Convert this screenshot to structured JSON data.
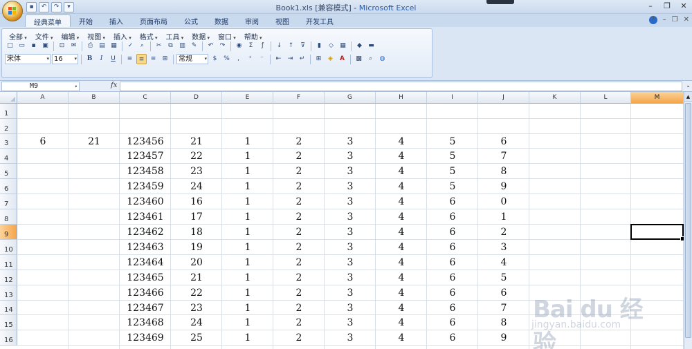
{
  "window": {
    "title_file": "Book1.xls",
    "title_mode": "[兼容模式]",
    "title_app": "Microsoft Excel"
  },
  "ribbon_tabs": [
    "经典菜单",
    "开始",
    "插入",
    "页面布局",
    "公式",
    "数据",
    "审阅",
    "视图",
    "开发工具"
  ],
  "classic_menus": [
    "全部",
    "文件",
    "编辑",
    "视图",
    "插入",
    "格式",
    "工具",
    "数据",
    "窗口",
    "帮助"
  ],
  "toolbar": {
    "font_name": "宋体",
    "font_size": "16",
    "bold": "B",
    "italic": "I",
    "underline": "U",
    "number_format": "常规",
    "percent": "%",
    "comma": ","
  },
  "formula_bar": {
    "name_box": "M9",
    "fx_label": "fx",
    "formula": ""
  },
  "columns": [
    "A",
    "B",
    "C",
    "D",
    "E",
    "F",
    "G",
    "H",
    "I",
    "J",
    "K",
    "L",
    "M"
  ],
  "selected_column": "M",
  "rows": [
    "1",
    "2",
    "3",
    "4",
    "5",
    "6",
    "7",
    "8",
    "9",
    "10",
    "11",
    "12",
    "13",
    "14",
    "15",
    "16"
  ],
  "selected_row": "9",
  "cells": {
    "A3": "6",
    "B3": "21",
    "C": [
      "123456",
      "123457",
      "123458",
      "123459",
      "123460",
      "123461",
      "123462",
      "123463",
      "123464",
      "123465",
      "123466",
      "123467",
      "123468",
      "123469"
    ],
    "D": [
      "21",
      "22",
      "23",
      "24",
      "16",
      "17",
      "18",
      "19",
      "20",
      "21",
      "22",
      "23",
      "24",
      "25"
    ],
    "E": [
      "1",
      "1",
      "1",
      "1",
      "1",
      "1",
      "1",
      "1",
      "1",
      "1",
      "1",
      "1",
      "1",
      "1"
    ],
    "F": [
      "2",
      "2",
      "2",
      "2",
      "2",
      "2",
      "2",
      "2",
      "2",
      "2",
      "2",
      "2",
      "2",
      "2"
    ],
    "G": [
      "3",
      "3",
      "3",
      "3",
      "3",
      "3",
      "3",
      "3",
      "3",
      "3",
      "3",
      "3",
      "3",
      "3"
    ],
    "H": [
      "4",
      "4",
      "4",
      "4",
      "4",
      "4",
      "4",
      "4",
      "4",
      "4",
      "4",
      "4",
      "4",
      "4"
    ],
    "I": [
      "5",
      "5",
      "5",
      "5",
      "6",
      "6",
      "6",
      "6",
      "6",
      "6",
      "6",
      "6",
      "6",
      "6"
    ],
    "J": [
      "6",
      "7",
      "8",
      "9",
      "0",
      "1",
      "2",
      "3",
      "4",
      "5",
      "6",
      "7",
      "8",
      "9"
    ]
  },
  "watermark": {
    "brand": "Bai du 经验",
    "url": "jingyan.baidu.com"
  }
}
